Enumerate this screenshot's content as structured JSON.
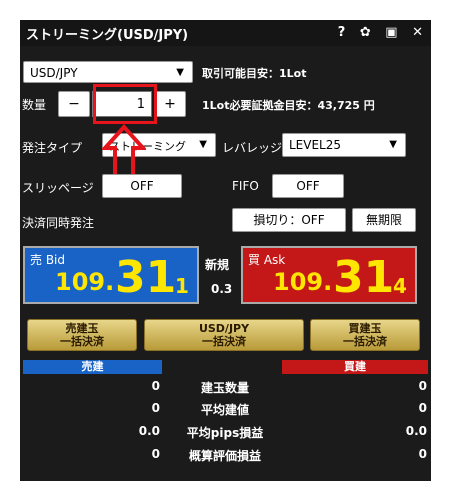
{
  "window": {
    "title": "ストリーミング(USD/JPY)"
  },
  "title_icons": {
    "help": "?",
    "settings": "✿",
    "popout": "▣",
    "close": "✕"
  },
  "pair_select": {
    "value": "USD/JPY"
  },
  "min_trade": "取引可能目安：1Lot",
  "quantity": {
    "label": "数量",
    "minus": "−",
    "value": "1",
    "plus": "+"
  },
  "margin_info": "1Lot必要証拠金目安：43,725 円",
  "order_type": {
    "label": "発注タイプ",
    "value": "ストリーミング"
  },
  "leverage": {
    "label": "レバレッジ",
    "value": "LEVEL25"
  },
  "slippage": {
    "label": "スリッページ",
    "value": "OFF"
  },
  "fifo": {
    "label": "FIFO",
    "value": "OFF"
  },
  "settle_simul": {
    "label": "決済同時発注"
  },
  "stoploss": {
    "label": "損切り：OFF"
  },
  "expiry": {
    "label": "無期限"
  },
  "bid": {
    "label": "売 Bid",
    "price_main": "109.",
    "price_big": "31",
    "price_small": "1"
  },
  "ask": {
    "label": "買 Ask",
    "price_main": "109.",
    "price_big": "31",
    "price_small": "4"
  },
  "spread": {
    "label": "新規",
    "value": "0.3"
  },
  "bulk": {
    "sell": [
      "売建玉",
      "一括決済"
    ],
    "pair": [
      "USD/JPY",
      "一括決済"
    ],
    "buy": [
      "買建玉",
      "一括決済"
    ]
  },
  "summary": {
    "sell_header": "売建",
    "buy_header": "買建",
    "rows": [
      {
        "left": "0",
        "label": "建玉数量",
        "right": "0"
      },
      {
        "left": "0",
        "label": "平均建値",
        "right": "0"
      },
      {
        "left": "0.0",
        "label": "平均pips損益",
        "right": "0.0"
      },
      {
        "left": "0",
        "label": "概算評価損益",
        "right": "0"
      }
    ]
  },
  "colors": {
    "bid": "#1a63c6",
    "ask": "#c41818",
    "highlight": "#e8141c",
    "price_text": "#ffe600"
  }
}
